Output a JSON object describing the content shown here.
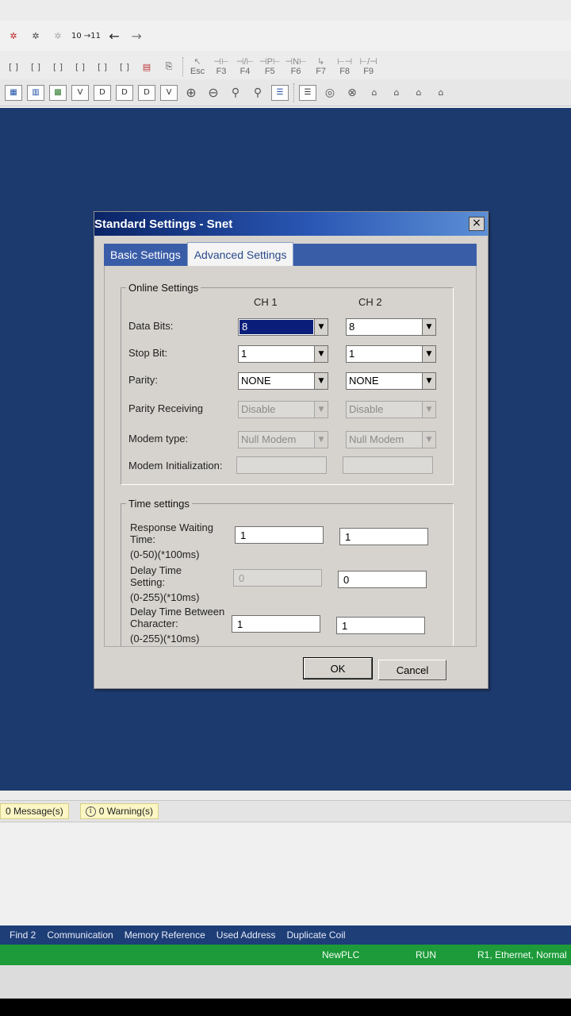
{
  "toolbar": {
    "row1_items": [
      "10 →11",
      "←",
      "→"
    ],
    "row2_items": [
      "[ ]",
      "[ ]",
      "[ ]",
      "[ ]",
      "[ ]",
      "[ ]"
    ],
    "fkeys": [
      {
        "sym": "↖",
        "label": "Esc"
      },
      {
        "sym": "⊣⊢",
        "label": "F3"
      },
      {
        "sym": "⊣/⊢",
        "label": "F4"
      },
      {
        "sym": "⊣P⊢",
        "label": "F5"
      },
      {
        "sym": "⊣N⊢",
        "label": "F6"
      },
      {
        "sym": "↳",
        "label": "F7"
      },
      {
        "sym": "⊢⊣",
        "label": "F8"
      },
      {
        "sym": "⊢/⊣",
        "label": "F9"
      }
    ]
  },
  "dialog": {
    "title": "Standard Settings - Snet",
    "close_symbol": "×",
    "tabs": [
      {
        "label": "Basic Settings",
        "active": false
      },
      {
        "label": "Advanced Settings",
        "active": true
      }
    ],
    "online": {
      "legend": "Online Settings",
      "ch1": "CH 1",
      "ch2": "CH 2",
      "rows": {
        "data_bits": {
          "label": "Data Bits:",
          "ch1": "8",
          "ch2": "8"
        },
        "stop_bit": {
          "label": "Stop Bit:",
          "ch1": "1",
          "ch2": "1"
        },
        "parity": {
          "label": "Parity:",
          "ch1": "NONE",
          "ch2": "NONE"
        },
        "parity_receiving": {
          "label": "Parity Receiving",
          "ch1": "Disable",
          "ch2": "Disable"
        },
        "modem_type": {
          "label": "Modem type:",
          "ch1": "Null Modem",
          "ch2": "Null Modem"
        },
        "modem_init": {
          "label": "Modem Initialization:",
          "ch1": "",
          "ch2": ""
        }
      }
    },
    "time": {
      "legend": "Time settings",
      "response": {
        "label1": "Response Waiting",
        "label2": "Time:",
        "range": "(0-50)(*100ms)",
        "ch1": "1",
        "ch2": "1"
      },
      "delay": {
        "label1": "Delay Time",
        "label2": "Setting:",
        "range": "(0-255)(*10ms)",
        "ch1": "0",
        "ch2": "0"
      },
      "between": {
        "label1": "Delay Time Between",
        "label2": "Character:",
        "range": "(0-255)(*10ms)",
        "ch1": "1",
        "ch2": "1"
      }
    },
    "ok_label": "OK",
    "cancel_label": "Cancel"
  },
  "messages": {
    "errors": "0 Message(s)",
    "warnings": "0 Warning(s)",
    "info_symbol": "i"
  },
  "bottom_tabs": [
    "Find 2",
    "Communication",
    "Memory Reference",
    "Used Address",
    "Duplicate Coil"
  ],
  "status": {
    "project": "NewPLC",
    "mode": "RUN",
    "connection": "R1, Ethernet, Normal"
  },
  "colors": {
    "workspace": "#1d3a6e",
    "title_bar": "#0a2466",
    "status_bar": "#1d9a3a",
    "selection": "#0b1f7a"
  }
}
